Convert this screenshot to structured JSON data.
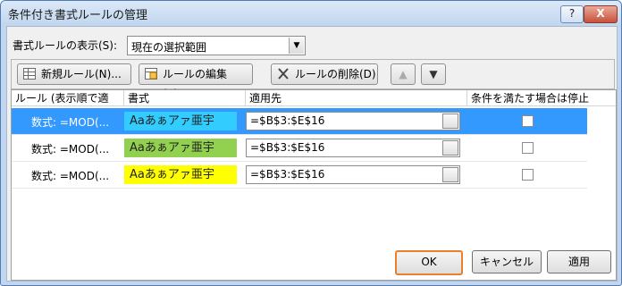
{
  "window": {
    "title": "条件付き書式ルールの管理",
    "help_label": "?",
    "close_label": "X"
  },
  "show_rules": {
    "label": "書式ルールの表示(S):",
    "selected": "現在の選択範囲"
  },
  "toolbar": {
    "new_label": "新規ルール(N)...",
    "edit_label": "ルールの編集(E)...",
    "delete_label": "ルールの削除(D)",
    "up_label": "▲",
    "down_label": "▼"
  },
  "table": {
    "headers": [
      "ルール (表示順で適用)",
      "書式",
      "適用先",
      "条件を満たす場合は停止"
    ],
    "rows": [
      {
        "rule": "数式: =MOD(...",
        "preview": "Aaあぁアァ亜宇",
        "preview_color": "#33ccff",
        "applies_to": "=$B$3:$E$16",
        "stop": false,
        "selected": true
      },
      {
        "rule": "数式: =MOD(...",
        "preview": "Aaあぁアァ亜宇",
        "preview_color": "#92d050",
        "applies_to": "=$B$3:$E$16",
        "stop": false,
        "selected": false
      },
      {
        "rule": "数式: =MOD(...",
        "preview": "Aaあぁアァ亜宇",
        "preview_color": "#ffff00",
        "applies_to": "=$B$3:$E$16",
        "stop": false,
        "selected": false
      }
    ]
  },
  "footer": {
    "ok_label": "OK",
    "cancel_label": "キャンセル",
    "apply_label": "適用"
  }
}
